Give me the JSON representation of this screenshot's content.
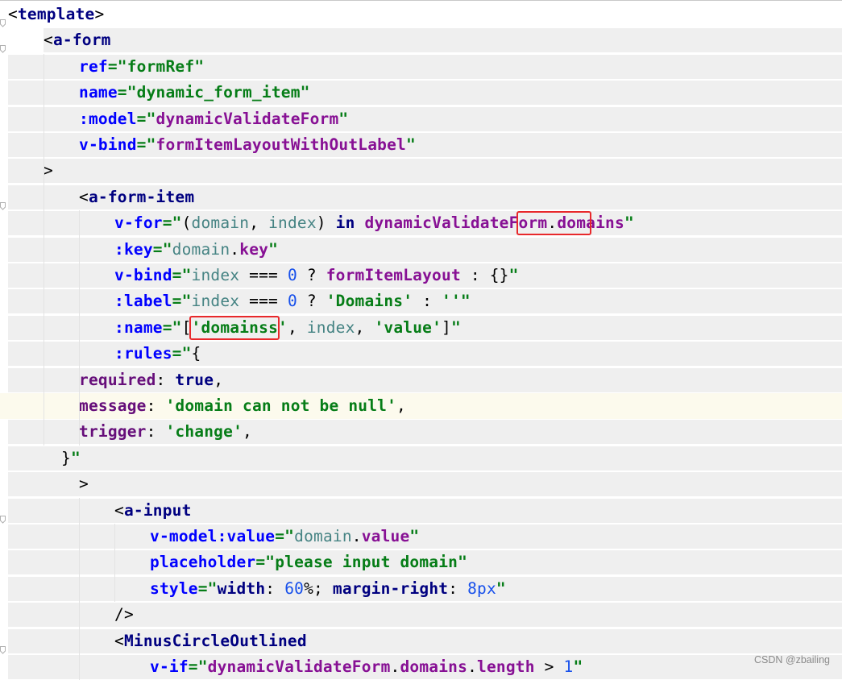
{
  "editor": {
    "language": "vue-template",
    "lines": [
      [
        [
          "<",
          "c-bracket"
        ],
        [
          "template",
          "c-tag"
        ],
        [
          ">",
          "c-bracket"
        ]
      ],
      [
        [
          "<",
          "c-bracket"
        ],
        [
          "a-form",
          "c-tag"
        ]
      ],
      [
        [
          "ref",
          "c-attr"
        ],
        [
          "=\"",
          "c-str"
        ],
        [
          "formRef",
          "c-str"
        ],
        [
          "\"",
          "c-str"
        ]
      ],
      [
        [
          "name",
          "c-attr"
        ],
        [
          "=\"",
          "c-str"
        ],
        [
          "dynamic_form_item",
          "c-str"
        ],
        [
          "\"",
          "c-str"
        ]
      ],
      [
        [
          ":model",
          "c-attr"
        ],
        [
          "=\"",
          "c-str"
        ],
        [
          "dynamicValidateForm",
          "c-purple"
        ],
        [
          "\"",
          "c-str"
        ]
      ],
      [
        [
          "v-bind",
          "c-attr"
        ],
        [
          "=\"",
          "c-str"
        ],
        [
          "formItemLayoutWithOutLabel",
          "c-purple"
        ],
        [
          "\"",
          "c-str"
        ]
      ],
      [
        [
          ">",
          "c-bracket"
        ]
      ],
      [
        [
          "<",
          "c-bracket"
        ],
        [
          "a-form-item",
          "c-tag"
        ]
      ],
      [
        [
          "v-for",
          "c-attr"
        ],
        [
          "=\"",
          "c-str"
        ],
        [
          "(",
          "c-plain"
        ],
        [
          "domain",
          "c-teal"
        ],
        [
          ", ",
          "c-plain"
        ],
        [
          "index",
          "c-teal"
        ],
        [
          ") ",
          "c-plain"
        ],
        [
          "in",
          "c-keyword"
        ],
        [
          " ",
          "c-plain"
        ],
        [
          "dynamicValidateForm",
          "c-purple"
        ],
        [
          ".",
          "c-plain"
        ],
        [
          "domains",
          "c-purple"
        ],
        [
          "\"",
          "c-str"
        ]
      ],
      [
        [
          ":key",
          "c-attr"
        ],
        [
          "=\"",
          "c-str"
        ],
        [
          "domain",
          "c-teal"
        ],
        [
          ".",
          "c-plain"
        ],
        [
          "key",
          "c-purple"
        ],
        [
          "\"",
          "c-str"
        ]
      ],
      [
        [
          "v-bind",
          "c-attr"
        ],
        [
          "=\"",
          "c-str"
        ],
        [
          "index",
          "c-teal"
        ],
        [
          " === ",
          "c-plain"
        ],
        [
          "0",
          "c-num"
        ],
        [
          " ? ",
          "c-plain"
        ],
        [
          "formItemLayout",
          "c-purple"
        ],
        [
          " : {}",
          "c-plain"
        ],
        [
          "\"",
          "c-str"
        ]
      ],
      [
        [
          ":label",
          "c-attr"
        ],
        [
          "=\"",
          "c-str"
        ],
        [
          "index",
          "c-teal"
        ],
        [
          " === ",
          "c-plain"
        ],
        [
          "0",
          "c-num"
        ],
        [
          " ? ",
          "c-plain"
        ],
        [
          "'Domains'",
          "c-str"
        ],
        [
          " : ",
          "c-plain"
        ],
        [
          "''",
          "c-str"
        ],
        [
          "\"",
          "c-str"
        ]
      ],
      [
        [
          ":name",
          "c-attr"
        ],
        [
          "=\"",
          "c-str"
        ],
        [
          "[",
          "c-plain"
        ],
        [
          "'domainss'",
          "c-str"
        ],
        [
          ", ",
          "c-plain"
        ],
        [
          "index",
          "c-teal"
        ],
        [
          ", ",
          "c-plain"
        ],
        [
          "'value'",
          "c-str"
        ],
        [
          "]",
          "c-plain"
        ],
        [
          "\"",
          "c-str"
        ]
      ],
      [
        [
          ":rules",
          "c-attr"
        ],
        [
          "=\"",
          "c-str"
        ],
        [
          "{",
          "c-plain"
        ]
      ],
      [
        [
          "required",
          "c-purplepl"
        ],
        [
          ": ",
          "c-plain"
        ],
        [
          "true",
          "c-keyword"
        ],
        [
          ",",
          "c-plain"
        ]
      ],
      [
        [
          "message",
          "c-purplepl"
        ],
        [
          ": ",
          "c-plain"
        ],
        [
          "'domain can not be null'",
          "c-str"
        ],
        [
          ",",
          "c-plain"
        ]
      ],
      [
        [
          "trigger",
          "c-purplepl"
        ],
        [
          ": ",
          "c-plain"
        ],
        [
          "'change'",
          "c-str"
        ],
        [
          ",",
          "c-plain"
        ]
      ],
      [
        [
          "}",
          "c-plain"
        ],
        [
          "\"",
          "c-str"
        ]
      ],
      [
        [
          ">",
          "c-bracket"
        ]
      ],
      [
        [
          "<",
          "c-bracket"
        ],
        [
          "a-input",
          "c-tag"
        ]
      ],
      [
        [
          "v-model:value",
          "c-attr"
        ],
        [
          "=\"",
          "c-str"
        ],
        [
          "domain",
          "c-teal"
        ],
        [
          ".",
          "c-plain"
        ],
        [
          "value",
          "c-purple"
        ],
        [
          "\"",
          "c-str"
        ]
      ],
      [
        [
          "placeholder",
          "c-attr"
        ],
        [
          "=\"",
          "c-str"
        ],
        [
          "please input domain",
          "c-str"
        ],
        [
          "\"",
          "c-str"
        ]
      ],
      [
        [
          "style",
          "c-attr"
        ],
        [
          "=\"",
          "c-str"
        ],
        [
          "width",
          "c-keyword"
        ],
        [
          ": ",
          "c-plain"
        ],
        [
          "60",
          "c-num"
        ],
        [
          "%",
          "c-plain"
        ],
        [
          "; ",
          "c-plain"
        ],
        [
          "margin-right",
          "c-keyword"
        ],
        [
          ": ",
          "c-plain"
        ],
        [
          "8px",
          "c-num"
        ],
        [
          "\"",
          "c-str"
        ]
      ],
      [
        [
          "/>",
          "c-bracket"
        ]
      ],
      [
        [
          "<",
          "c-bracket"
        ],
        [
          "MinusCircleOutlined",
          "c-tag"
        ]
      ],
      [
        [
          "v-if",
          "c-attr"
        ],
        [
          "=\"",
          "c-str"
        ],
        [
          "dynamicValidateForm",
          "c-purple"
        ],
        [
          ".",
          "c-plain"
        ],
        [
          "domains",
          "c-purple"
        ],
        [
          ".",
          "c-plain"
        ],
        [
          "length",
          "c-purple"
        ],
        [
          " > ",
          "c-plain"
        ],
        [
          "1",
          "c-num"
        ],
        [
          "\"",
          "c-str"
        ]
      ]
    ]
  },
  "watermark": "CSDN @zbailing"
}
